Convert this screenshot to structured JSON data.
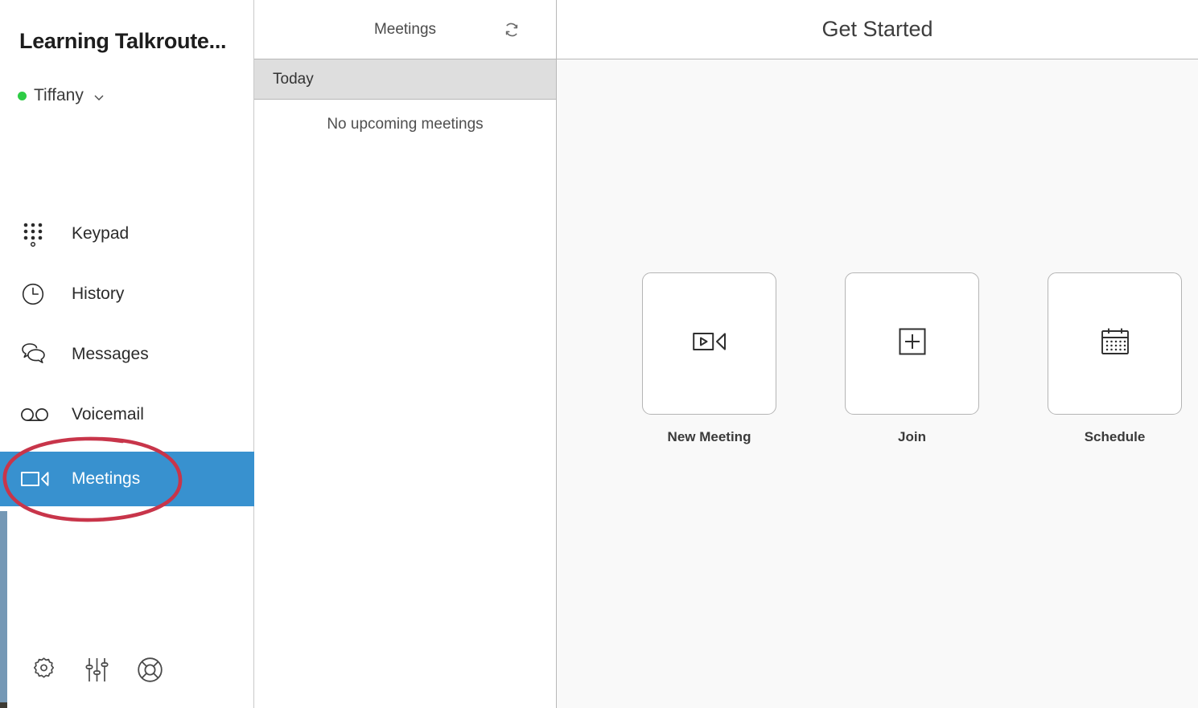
{
  "window": {
    "edge_strip_color": "#7598b5"
  },
  "sidebar": {
    "brand_title": "Learning Talkroute...",
    "user": {
      "name": "Tiffany",
      "status_color": "#2ecc45",
      "chevron_icon": "chevron-down-icon"
    },
    "active_color": "#3891cf",
    "items": [
      {
        "label": "Keypad",
        "icon": "keypad-icon",
        "active": false
      },
      {
        "label": "History",
        "icon": "clock-icon",
        "active": false
      },
      {
        "label": "Messages",
        "icon": "chat-bubbles-icon",
        "active": false
      },
      {
        "label": "Voicemail",
        "icon": "voicemail-icon",
        "active": false
      },
      {
        "label": "Meetings",
        "icon": "video-camera-icon",
        "active": true
      }
    ],
    "bottom_icons": [
      {
        "name": "gear-icon"
      },
      {
        "name": "sliders-icon"
      },
      {
        "name": "lifebuoy-icon"
      }
    ]
  },
  "meetings_panel": {
    "title": "Meetings",
    "refresh_icon": "refresh-icon",
    "section_label": "Today",
    "empty_message": "No upcoming meetings"
  },
  "get_started": {
    "title": "Get Started",
    "cards": [
      {
        "label": "New Meeting",
        "icon": "video-camera-play-icon"
      },
      {
        "label": "Join",
        "icon": "plus-square-icon"
      },
      {
        "label": "Schedule",
        "icon": "calendar-icon"
      }
    ]
  },
  "annotation": {
    "shape": "ellipse",
    "color": "#c8354a",
    "targets": "Meetings"
  }
}
